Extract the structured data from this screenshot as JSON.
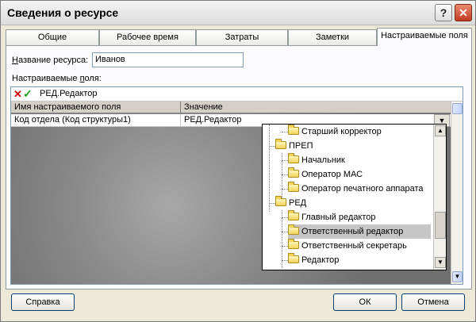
{
  "window": {
    "title": "Сведения о ресурсе"
  },
  "titlebar": {
    "help_glyph": "?",
    "close_glyph": "✕"
  },
  "tabs": [
    {
      "label": "Общие"
    },
    {
      "label": "Рабочее время"
    },
    {
      "label": "Затраты"
    },
    {
      "label": "Заметки"
    },
    {
      "label": "Настраиваемые поля"
    }
  ],
  "name": {
    "label_prefix": "Н",
    "label_rest": "азвание ресурса:",
    "value": "Иванов"
  },
  "custom": {
    "label_prefix": "Настраиваемые ",
    "label_u": "п",
    "label_rest": "оля:"
  },
  "editbar": {
    "cancel_glyph": "✕",
    "accept_glyph": "✓",
    "value": "РЕД.Редактор"
  },
  "table": {
    "headers": [
      "Имя настраиваемого поля",
      "Значение"
    ],
    "rows": [
      {
        "field": "Код отдела (Код структуры1)",
        "value": "РЕД.Редактор"
      }
    ]
  },
  "tree": {
    "items": [
      {
        "label": "Старший корректор",
        "level": 1
      },
      {
        "label": "ПРЕП",
        "level": 0
      },
      {
        "label": "Начальник",
        "level": 1
      },
      {
        "label": "Оператор МАС",
        "level": 1
      },
      {
        "label": "Оператор печатного аппарата",
        "level": 1
      },
      {
        "label": "РЕД",
        "level": 0
      },
      {
        "label": "Главный редактор",
        "level": 1
      },
      {
        "label": "Ответственный редактор",
        "level": 1,
        "selected": true
      },
      {
        "label": "Ответственный секретарь",
        "level": 1
      },
      {
        "label": "Редактор",
        "level": 1
      }
    ]
  },
  "buttons": {
    "help": "Справка",
    "ok": "ОК",
    "cancel": "Отмена"
  },
  "icons": {
    "folder": "folder-icon",
    "dropdown": "chevron-down-icon"
  }
}
